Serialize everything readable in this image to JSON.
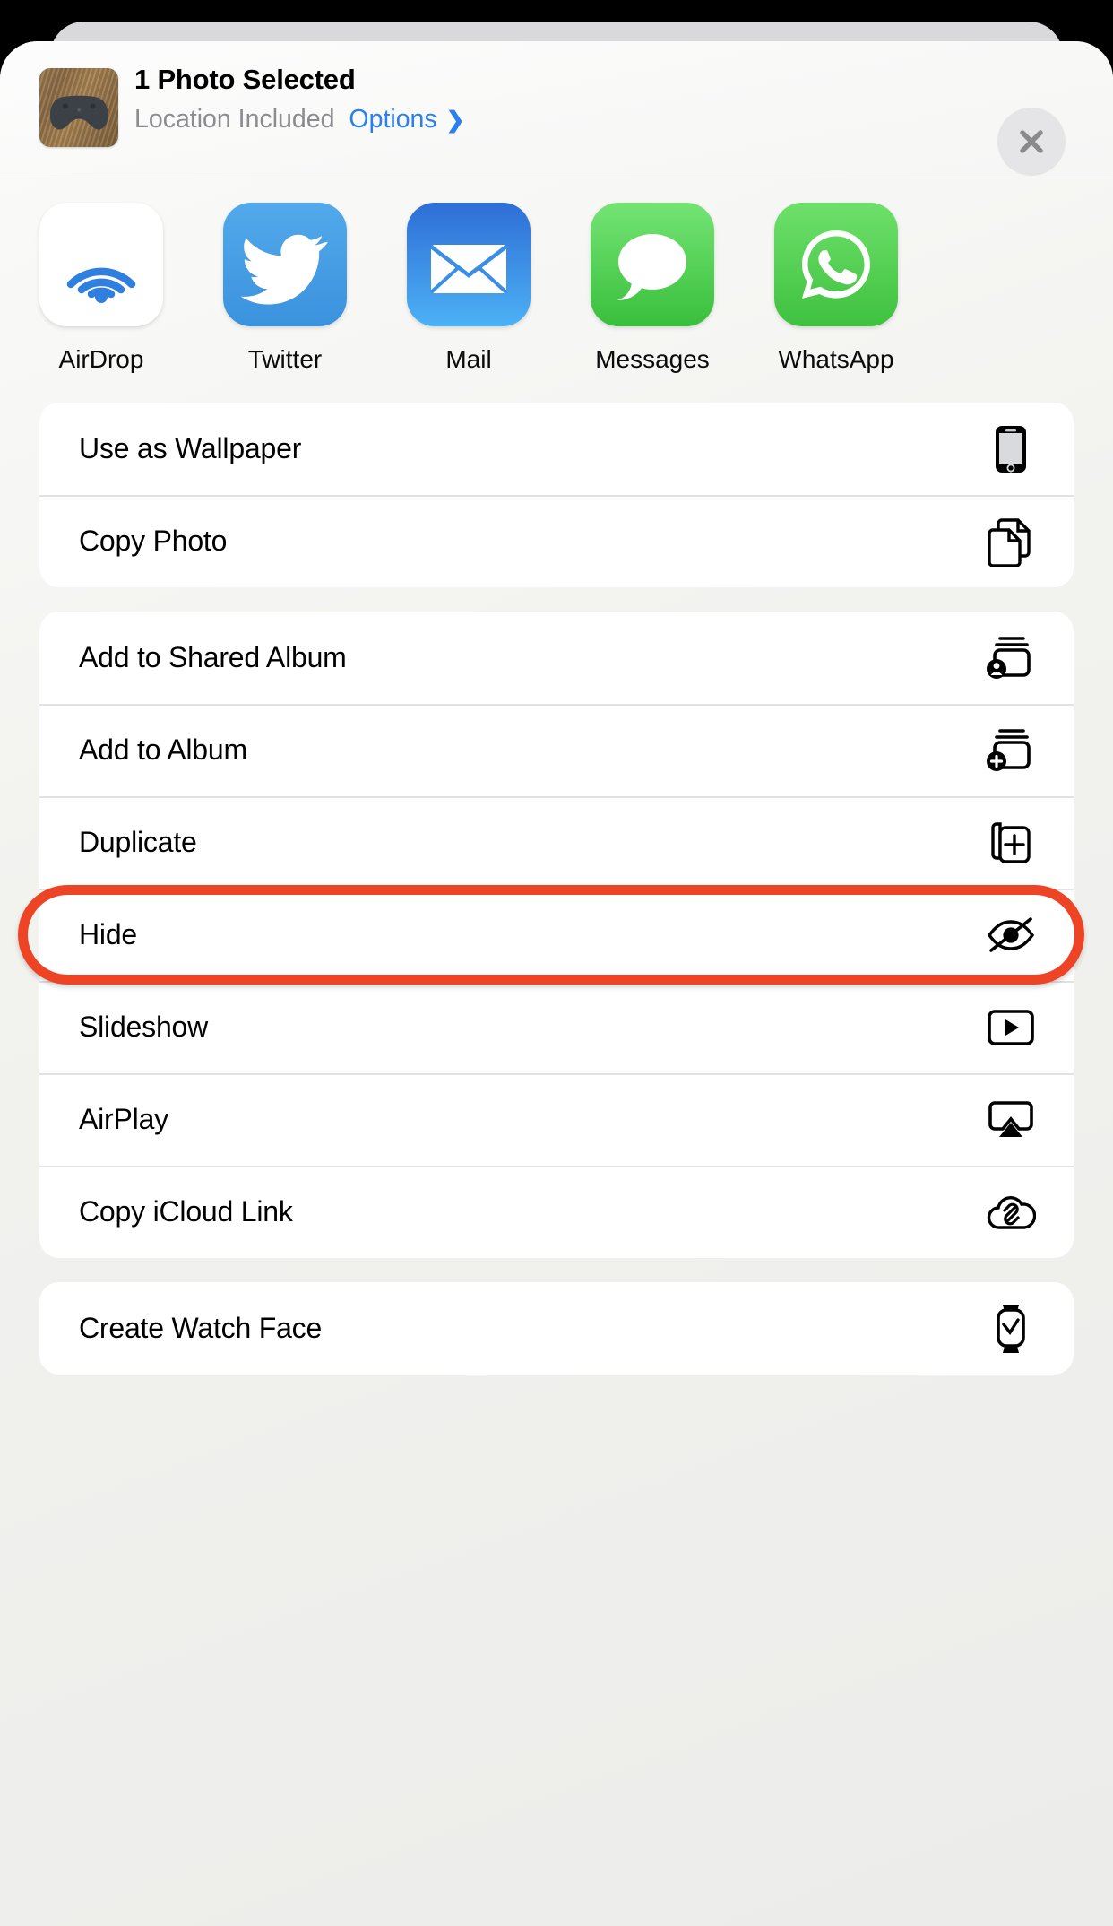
{
  "header": {
    "title": "1 Photo Selected",
    "subtitle": "Location Included",
    "options_label": "Options",
    "options_chevron": "❯",
    "close_icon": "close-icon",
    "thumbnail_icon": "photo-thumbnail-game-controller"
  },
  "apps": [
    {
      "label": "AirDrop",
      "icon": "airdrop-icon",
      "color": "#ffffff"
    },
    {
      "label": "Twitter",
      "icon": "twitter-icon",
      "color": "#46a0e4"
    },
    {
      "label": "Mail",
      "icon": "mail-icon",
      "color": "#3a8ee4"
    },
    {
      "label": "Messages",
      "icon": "messages-icon",
      "color": "#4fcf51"
    },
    {
      "label": "WhatsApp",
      "icon": "whatsapp-icon",
      "color": "#4fcf4c"
    }
  ],
  "action_groups": [
    {
      "rows": [
        {
          "label": "Use as Wallpaper",
          "icon": "iphone-icon"
        },
        {
          "label": "Copy Photo",
          "icon": "copy-document-icon"
        }
      ]
    },
    {
      "rows": [
        {
          "label": "Add to Shared Album",
          "icon": "shared-album-icon"
        },
        {
          "label": "Add to Album",
          "icon": "add-to-album-icon"
        },
        {
          "label": "Duplicate",
          "icon": "duplicate-icon"
        },
        {
          "label": "Hide",
          "icon": "eye-slash-icon"
        },
        {
          "label": "Slideshow",
          "icon": "play-rectangle-icon"
        },
        {
          "label": "AirPlay",
          "icon": "airplay-icon"
        },
        {
          "label": "Copy iCloud Link",
          "icon": "cloud-link-icon"
        }
      ]
    },
    {
      "rows": [
        {
          "label": "Create Watch Face",
          "icon": "apple-watch-icon"
        }
      ]
    }
  ],
  "annotation": {
    "target_label": "Hide",
    "color": "#ec4424"
  },
  "colors": {
    "accent_blue": "#2a7ff0",
    "sheet_bg": "#ececea",
    "card_bg": "#ffffff",
    "divider": "#e2e2e2",
    "secondary_text": "#8b8b90",
    "highlight_red": "#ec4424"
  }
}
